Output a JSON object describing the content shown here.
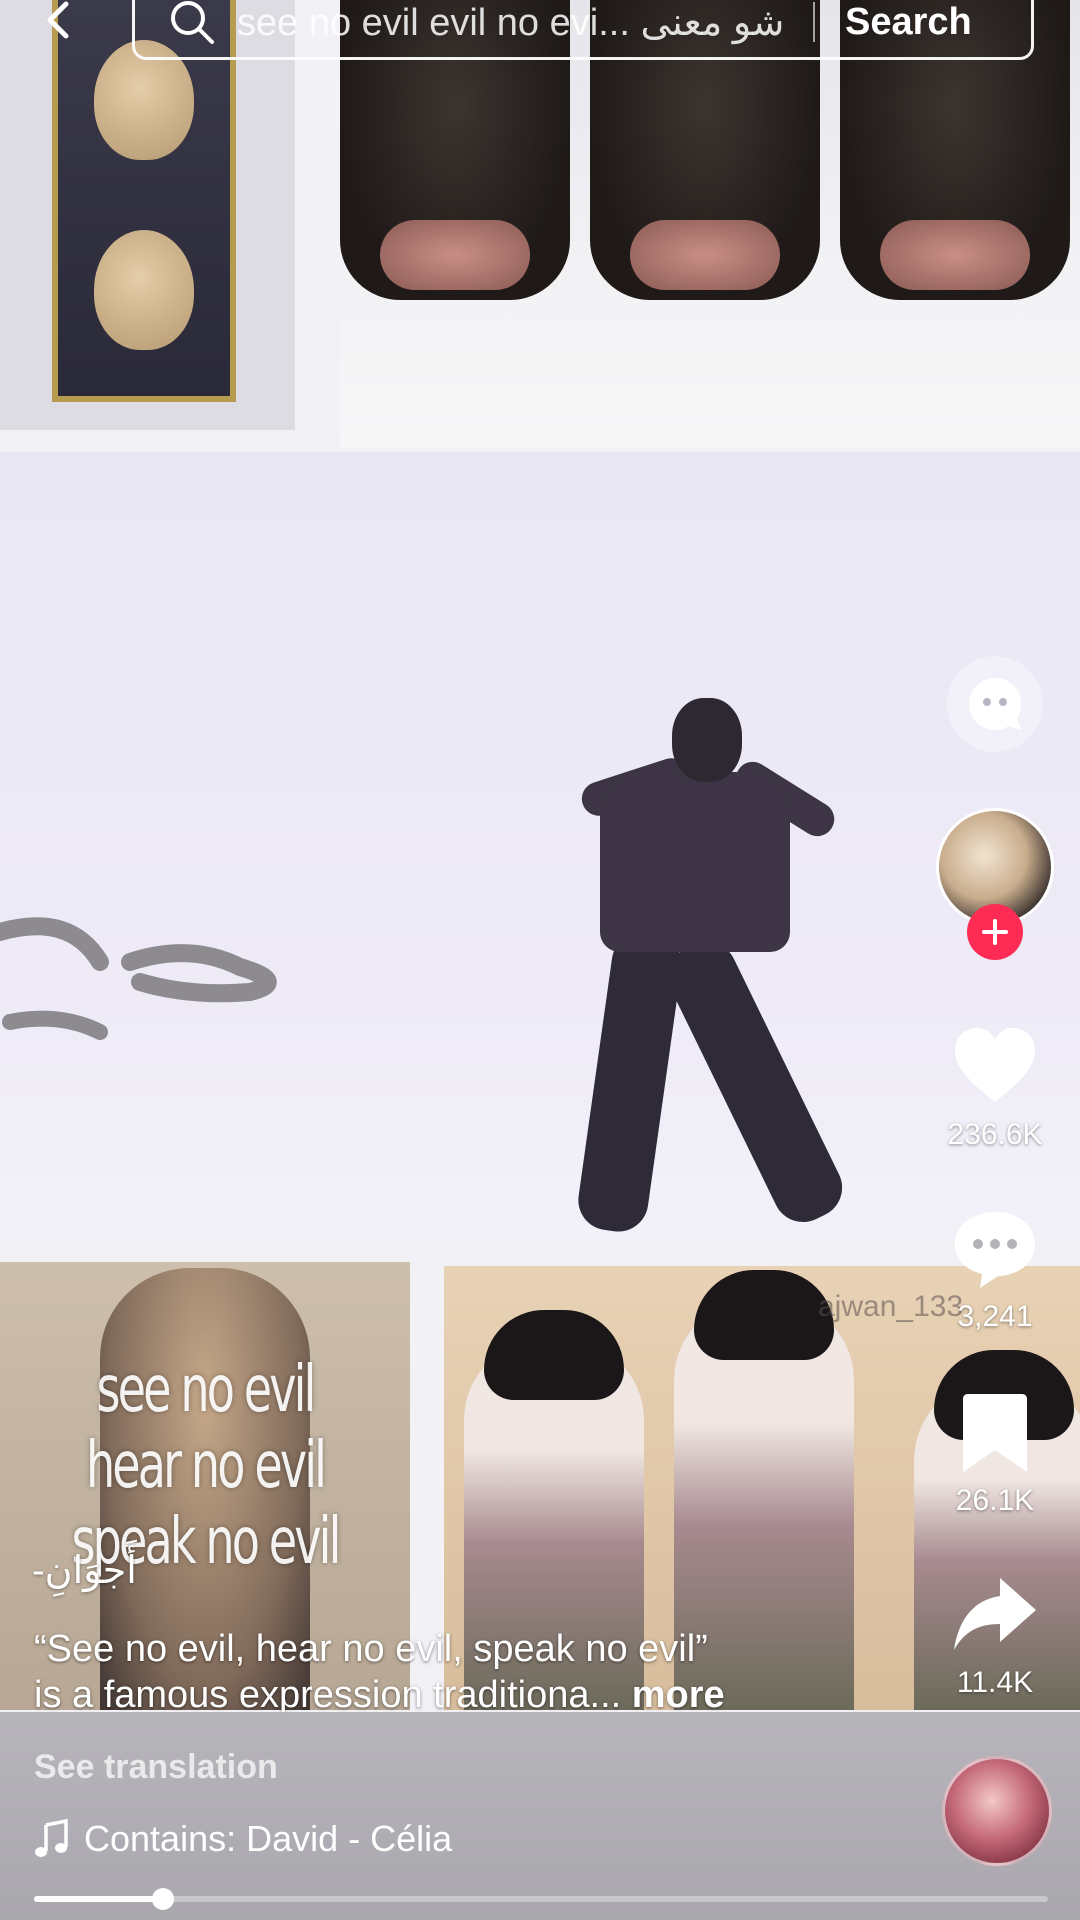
{
  "search": {
    "query": "see no evil evil no evi... شو معنى",
    "button_label": "Search"
  },
  "video": {
    "overlay_text": [
      "see no evil",
      "hear no evil",
      "speak no evil"
    ],
    "watermark": "ajwan_133"
  },
  "actions": {
    "likes": "236.6K",
    "comments": "3,241",
    "saves": "26.1K",
    "shares": "11.4K"
  },
  "post": {
    "author": "-أَجوَانِ",
    "caption_line1": "“See no evil, hear no evil, speak no evil”",
    "caption_line2": "is a famous expression traditiona...",
    "more_label": "more",
    "see_translation": "See translation",
    "sound": "Contains: David - Célia"
  },
  "playback": {
    "progress_fraction": 0.127
  },
  "icons": {
    "back": "chevron-left-icon",
    "search": "search-icon",
    "assistant": "ai-assistant-icon",
    "like": "heart-icon",
    "comment": "comment-icon",
    "save": "bookmark-icon",
    "share": "share-icon",
    "follow": "plus-icon",
    "music": "music-note-icon"
  },
  "colors": {
    "follow_accent": "#fe2c55",
    "text": "#ffffff"
  }
}
